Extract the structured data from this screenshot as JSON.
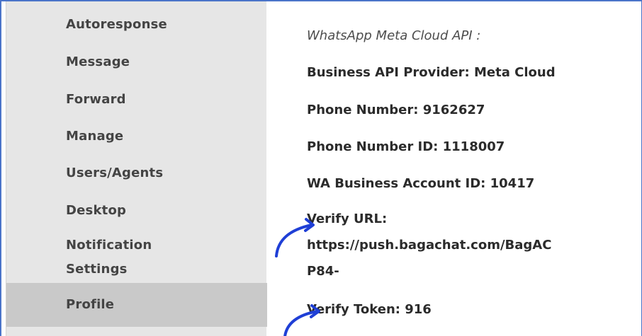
{
  "sidebar": {
    "items": [
      {
        "label": "Autoresponse"
      },
      {
        "label": "Message"
      },
      {
        "label": "Forward"
      },
      {
        "label": "Manage"
      },
      {
        "label": "Users/Agents"
      },
      {
        "label": "Desktop"
      },
      {
        "label": "Notification",
        "label2": "Settings"
      },
      {
        "label": "Profile",
        "active": true
      }
    ]
  },
  "main": {
    "section_title": "WhatsApp Meta Cloud API :",
    "provider": "Business API Provider: Meta Cloud",
    "phone_number": "Phone Number: 9162627",
    "phone_number_id": "Phone Number ID: 1118007",
    "wa_business_account_id": "WA Business Account ID: 10417",
    "verify_url_label": "Verify URL:",
    "verify_url_value": "https://push.bagachat.com/BagAC",
    "verify_url_value2": "P84-",
    "verify_token": "Verify Token: 916"
  },
  "colors": {
    "frame_border": "#4a74c9",
    "sidebar_bg": "#e6e6e6",
    "sidebar_active_bg": "#c9c9c9",
    "annotation_arrow": "#1f3fd6"
  },
  "icons": {
    "annotation": "curved-arrow-icon"
  }
}
